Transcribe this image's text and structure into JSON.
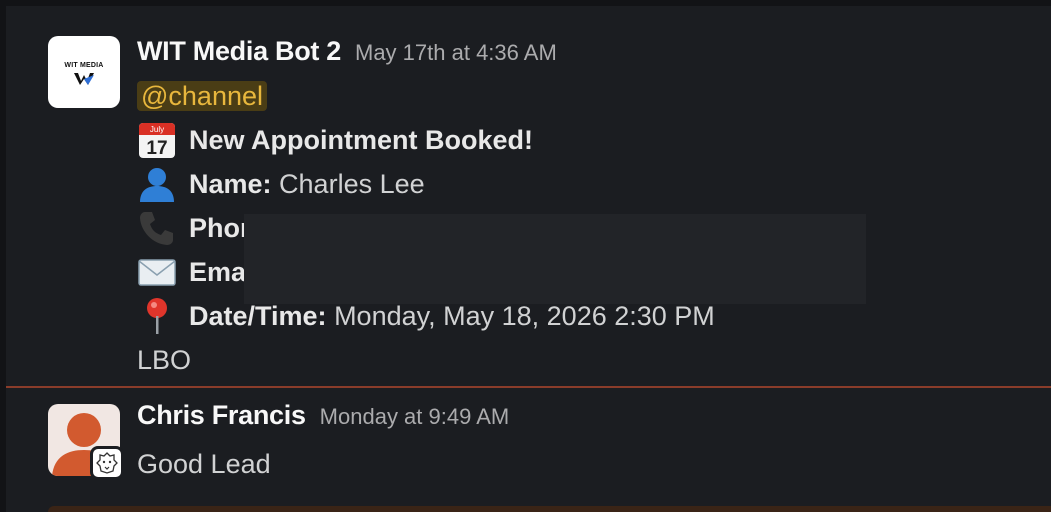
{
  "messages": [
    {
      "sender": "WIT Media Bot 2",
      "timestamp": "May 17th at 4:36 AM",
      "avatar_text": "WIT MEDIA",
      "mention": "@channel",
      "title": "New Appointment Booked!",
      "calendar_month": "July",
      "calendar_day": "17",
      "name_label": "Name:",
      "name_value": "Charles Lee",
      "phone_label": "Phor",
      "email_label": "Ema",
      "datetime_label": "Date/Time:",
      "datetime_value": "Monday, May 18, 2026 2:30 PM",
      "footer": "LBO"
    },
    {
      "sender": "Chris Francis",
      "timestamp": "Monday at 9:49 AM",
      "text": "Good Lead"
    }
  ],
  "colors": {
    "background": "#1b1d21",
    "mention_text": "#e8b73d",
    "mention_bg": "#4a3d15",
    "divider": "#8a3c2a",
    "avatar_person": "#d25a2f"
  },
  "icons": [
    "calendar-icon",
    "person-icon",
    "phone-icon",
    "envelope-icon",
    "pin-icon",
    "lion-badge-icon"
  ]
}
